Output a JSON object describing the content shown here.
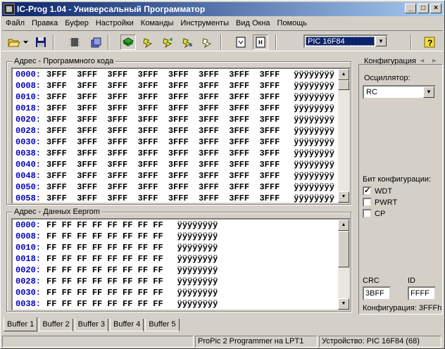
{
  "window": {
    "title": "IC-Prog 1.04 - Универсальный Программатор",
    "minimize": "_",
    "maximize": "□",
    "close": "×"
  },
  "menu": [
    "Файл",
    "Правка",
    "Буфер",
    "Настройки",
    "Команды",
    "Инструменты",
    "Вид Окна",
    "Помощь"
  ],
  "toolbar": {
    "device": "PIC 16F84",
    "icons": [
      "open-icon",
      "dropdown-arrow-icon",
      "save-icon",
      "chip-icon",
      "config-icon",
      "read-icon",
      "program-icon",
      "erase-icon",
      "verify-icon",
      "blank-check-icon",
      "view-asm-icon",
      "view-hex-icon",
      "help-icon"
    ]
  },
  "program_memory": {
    "label": "Адрес - Программного кода",
    "rows": [
      {
        "addr": "0000:",
        "data": "3FFF  3FFF  3FFF  3FFF  3FFF  3FFF  3FFF  3FFF",
        "ascii": "ÿÿÿÿÿÿÿÿ"
      },
      {
        "addr": "0008:",
        "data": "3FFF  3FFF  3FFF  3FFF  3FFF  3FFF  3FFF  3FFF",
        "ascii": "ÿÿÿÿÿÿÿÿ"
      },
      {
        "addr": "0010:",
        "data": "3FFF  3FFF  3FFF  3FFF  3FFF  3FFF  3FFF  3FFF",
        "ascii": "ÿÿÿÿÿÿÿÿ"
      },
      {
        "addr": "0018:",
        "data": "3FFF  3FFF  3FFF  3FFF  3FFF  3FFF  3FFF  3FFF",
        "ascii": "ÿÿÿÿÿÿÿÿ"
      },
      {
        "addr": "0020:",
        "data": "3FFF  3FFF  3FFF  3FFF  3FFF  3FFF  3FFF  3FFF",
        "ascii": "ÿÿÿÿÿÿÿÿ"
      },
      {
        "addr": "0028:",
        "data": "3FFF  3FFF  3FFF  3FFF  3FFF  3FFF  3FFF  3FFF",
        "ascii": "ÿÿÿÿÿÿÿÿ"
      },
      {
        "addr": "0030:",
        "data": "3FFF  3FFF  3FFF  3FFF  3FFF  3FFF  3FFF  3FFF",
        "ascii": "ÿÿÿÿÿÿÿÿ"
      },
      {
        "addr": "0038:",
        "data": "3FFF  3FFF  3FFF  3FFF  3FFF  3FFF  3FFF  3FFF",
        "ascii": "ÿÿÿÿÿÿÿÿ"
      },
      {
        "addr": "0040:",
        "data": "3FFF  3FFF  3FFF  3FFF  3FFF  3FFF  3FFF  3FFF",
        "ascii": "ÿÿÿÿÿÿÿÿ"
      },
      {
        "addr": "0048:",
        "data": "3FFF  3FFF  3FFF  3FFF  3FFF  3FFF  3FFF  3FFF",
        "ascii": "ÿÿÿÿÿÿÿÿ"
      },
      {
        "addr": "0050:",
        "data": "3FFF  3FFF  3FFF  3FFF  3FFF  3FFF  3FFF  3FFF",
        "ascii": "ÿÿÿÿÿÿÿÿ"
      },
      {
        "addr": "0058:",
        "data": "3FFF  3FFF  3FFF  3FFF  3FFF  3FFF  3FFF  3FFF",
        "ascii": "ÿÿÿÿÿÿÿÿ"
      }
    ]
  },
  "eeprom": {
    "label": "Адрес - Данных Eeprom",
    "rows": [
      {
        "addr": "0000:",
        "data": "FF FF FF FF FF FF FF FF",
        "ascii": "ÿÿÿÿÿÿÿÿ"
      },
      {
        "addr": "0008:",
        "data": "FF FF FF FF FF FF FF FF",
        "ascii": "ÿÿÿÿÿÿÿÿ"
      },
      {
        "addr": "0010:",
        "data": "FF FF FF FF FF FF FF FF",
        "ascii": "ÿÿÿÿÿÿÿÿ"
      },
      {
        "addr": "0018:",
        "data": "FF FF FF FF FF FF FF FF",
        "ascii": "ÿÿÿÿÿÿÿÿ"
      },
      {
        "addr": "0020:",
        "data": "FF FF FF FF FF FF FF FF",
        "ascii": "ÿÿÿÿÿÿÿÿ"
      },
      {
        "addr": "0028:",
        "data": "FF FF FF FF FF FF FF FF",
        "ascii": "ÿÿÿÿÿÿÿÿ"
      },
      {
        "addr": "0030:",
        "data": "FF FF FF FF FF FF FF FF",
        "ascii": "ÿÿÿÿÿÿÿÿ"
      },
      {
        "addr": "0038:",
        "data": "FF FF FF FF FF FF FF FF",
        "ascii": "ÿÿÿÿÿÿÿÿ"
      }
    ]
  },
  "config": {
    "title": "Конфигурация",
    "arrows": "◄ ►",
    "oscillator_label": "Осциллятор:",
    "oscillator_value": "RC",
    "bits_label": "Бит конфигурации:",
    "bits": [
      {
        "label": "WDT",
        "checked": "✓"
      },
      {
        "label": "PWRT",
        "checked": ""
      },
      {
        "label": "CP",
        "checked": ""
      }
    ],
    "crc_label": "CRC",
    "crc_value": "3BFF",
    "id_label": "ID",
    "id_value": "FFFF",
    "config_word": "Конфигурация: 3FFFh"
  },
  "tabs": [
    "Buffer 1",
    "Buffer 2",
    "Buffer 3",
    "Buffer 4",
    "Buffer 5"
  ],
  "status": {
    "programmer": "ProPic 2 Programmer на LPT1",
    "device": "Устройство: PIC 16F84   (68)"
  },
  "colors": {
    "address": "#0000c0",
    "title_start": "#0a246a",
    "title_end": "#a6caf0",
    "face": "#d4d0c8"
  }
}
